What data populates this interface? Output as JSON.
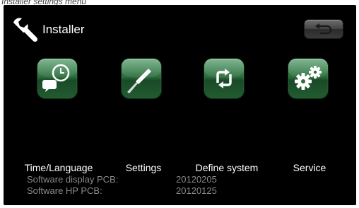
{
  "caption": "Installer settings menu",
  "header": {
    "title": "Installer",
    "icon": "wrench-icon",
    "back_icon": "back-arrow-icon"
  },
  "menu": {
    "items": [
      {
        "label": "Time/Language",
        "icon": "clock-speech-icon"
      },
      {
        "label": "Settings",
        "icon": "screwdriver-icon"
      },
      {
        "label": "Define system",
        "icon": "cycle-arrows-icon"
      },
      {
        "label": "Service",
        "icon": "gears-icon"
      }
    ]
  },
  "info": {
    "rows": [
      {
        "label": "Software display PCB:",
        "value": "20120205"
      },
      {
        "label": "Software HP PCB:",
        "value": "20120125"
      }
    ]
  },
  "colors": {
    "background": "#000000",
    "tile_green": "#2b6e3d",
    "text": "#ffffff",
    "info_text": "#8a8a8a"
  }
}
